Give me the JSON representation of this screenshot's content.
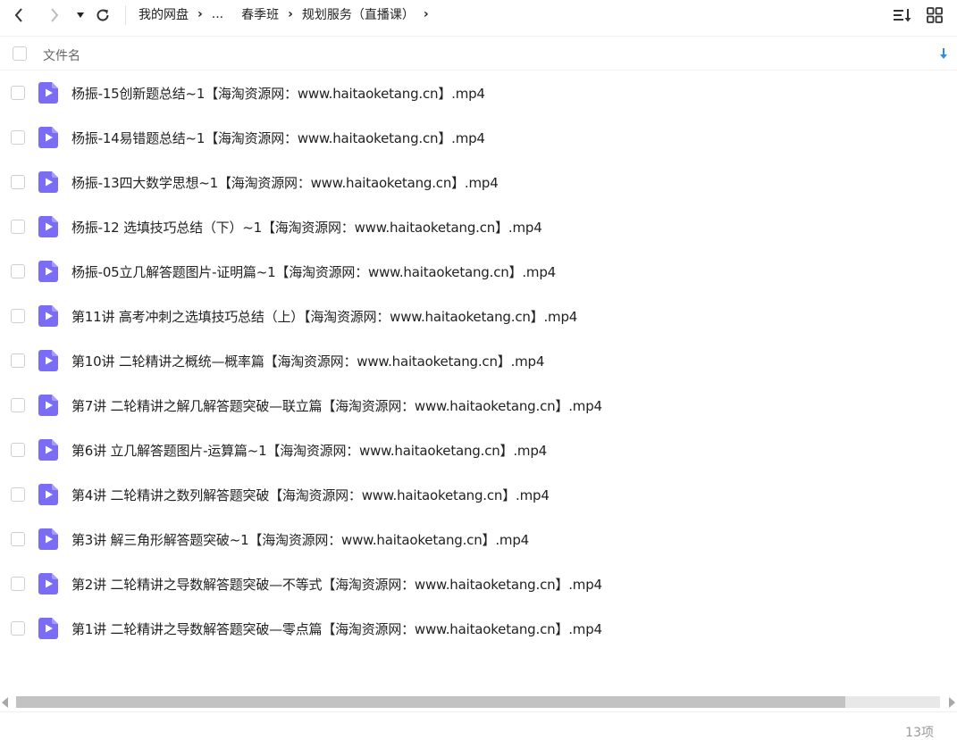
{
  "toolbar": {
    "breadcrumb": [
      "我的网盘",
      "...",
      "春季班",
      "规划服务（直播课）"
    ]
  },
  "header": {
    "column_name": "文件名"
  },
  "files": [
    "杨振-15创新题总结~1【海淘资源网：www.haitaoketang.cn】.mp4",
    "杨振-14易错题总结~1【海淘资源网：www.haitaoketang.cn】.mp4",
    "杨振-13四大数学思想~1【海淘资源网：www.haitaoketang.cn】.mp4",
    "杨振-12 选填技巧总结（下）~1【海淘资源网：www.haitaoketang.cn】.mp4",
    "杨振-05立几解答题图片-证明篇~1【海淘资源网：www.haitaoketang.cn】.mp4",
    "第11讲 高考冲刺之选填技巧总结（上）【海淘资源网：www.haitaoketang.cn】.mp4",
    "第10讲 二轮精讲之概统—概率篇【海淘资源网：www.haitaoketang.cn】.mp4",
    "第7讲 二轮精讲之解几解答题突破—联立篇【海淘资源网：www.haitaoketang.cn】.mp4",
    "第6讲 立几解答题图片-运算篇~1【海淘资源网：www.haitaoketang.cn】.mp4",
    "第4讲 二轮精讲之数列解答题突破【海淘资源网：www.haitaoketang.cn】.mp4",
    "第3讲 解三角形解答题突破~1【海淘资源网：www.haitaoketang.cn】.mp4",
    "第2讲 二轮精讲之导数解答题突破—不等式【海淘资源网：www.haitaoketang.cn】.mp4",
    "第1讲 二轮精讲之导数解答题突破—零点篇【海淘资源网：www.haitaoketang.cn】.mp4"
  ],
  "footer": {
    "count": "13项"
  },
  "colors": {
    "video_icon": "#7b6cf6",
    "accent": "#2b8cf0"
  },
  "icons": {
    "back": "arrow-left-icon",
    "forward": "arrow-right-icon",
    "dropdown": "caret-down-icon",
    "refresh": "refresh-icon",
    "sort": "sort-list-icon",
    "grid": "grid-view-icon",
    "sort_arrow": "arrow-down-icon",
    "file": "video-file-icon"
  }
}
